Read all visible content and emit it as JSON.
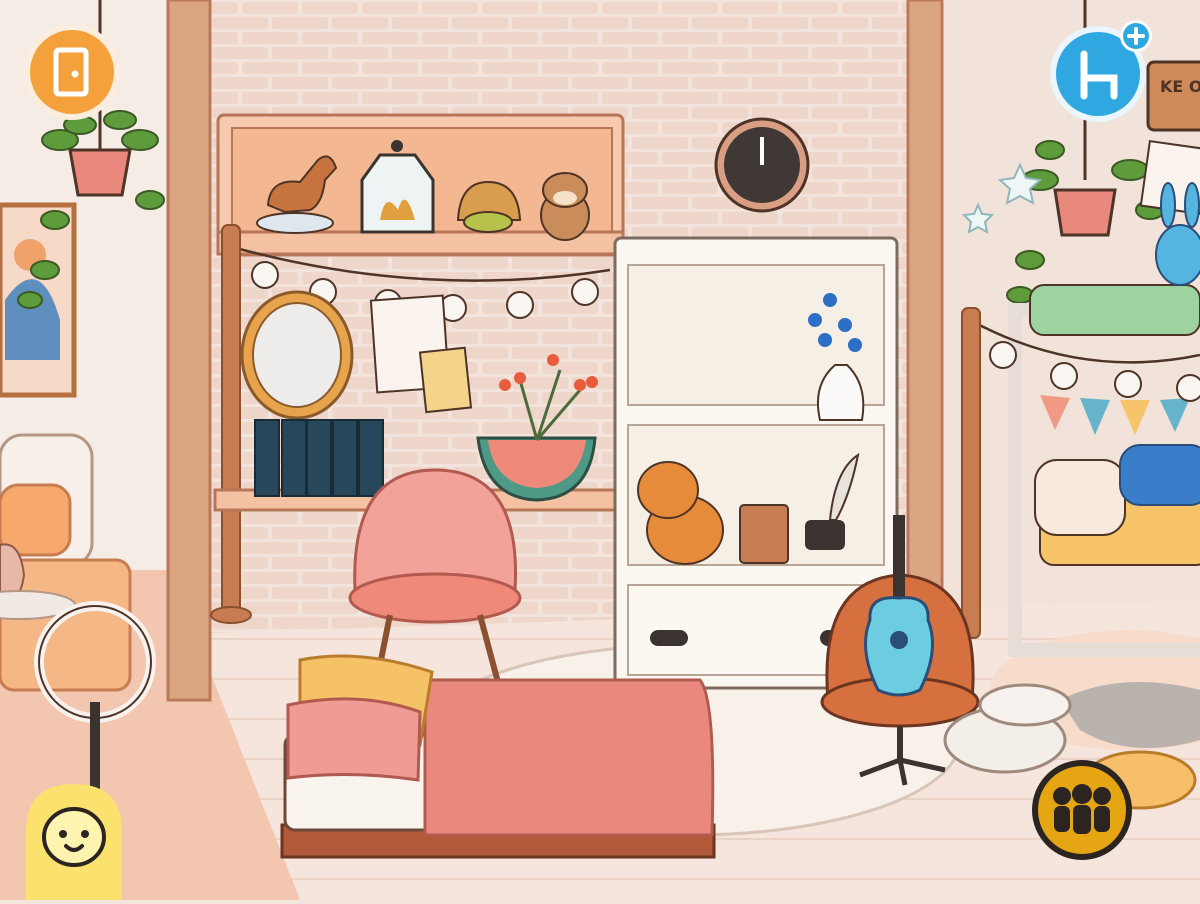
{
  "game": {
    "scene": "bedroom",
    "colors": {
      "wall": "#f2e4dc",
      "brick": "#efd7cb",
      "beam": "#d9a07e",
      "floor": "#f4e2d9",
      "shelf_white": "#faf6f0",
      "bed_pink": "#e9897d",
      "orange_button": "#f4a13c",
      "blue_button": "#2fa7e0",
      "yellow_button": "#fbe26e",
      "gold_button": "#e6a512",
      "outline": "#4e3426"
    }
  },
  "hud": {
    "exit_button": {
      "icon": "door-exit-icon"
    },
    "furniture_button": {
      "icon": "chair-add-icon"
    },
    "character_button": {
      "icon": "baby-face-icon"
    },
    "group_button": {
      "icon": "characters-group-icon"
    }
  },
  "decor": {
    "banner_text": "KE OL"
  }
}
